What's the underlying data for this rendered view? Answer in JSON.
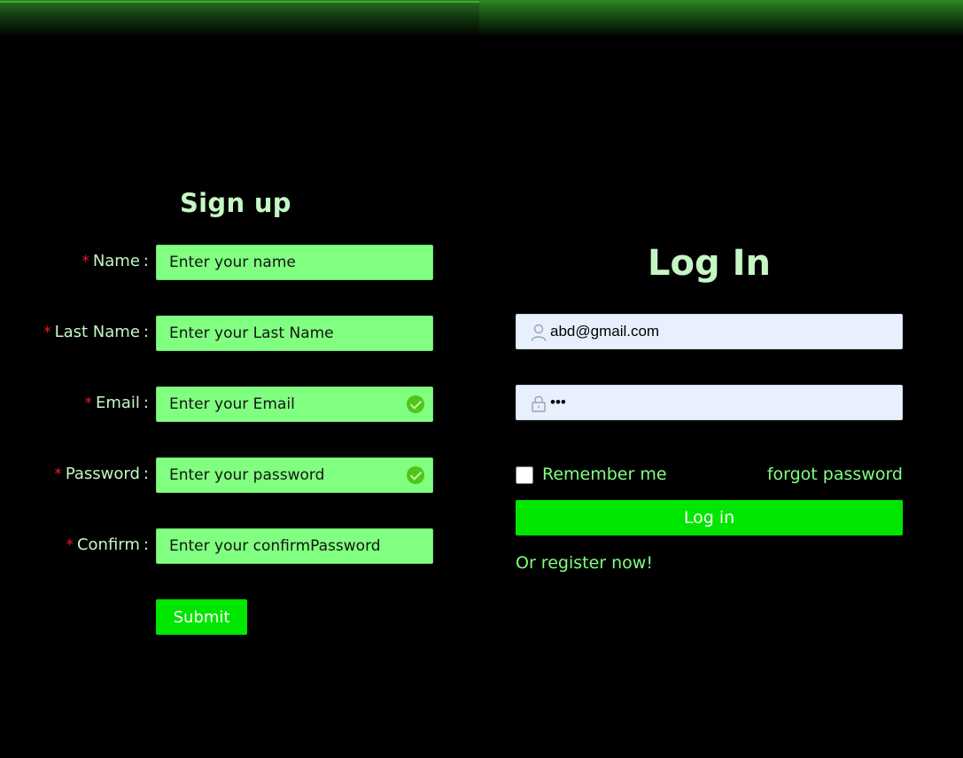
{
  "signup": {
    "title": "Sign up",
    "fields": [
      {
        "label": "Name",
        "placeholder": "Enter your name"
      },
      {
        "label": "Last Name",
        "placeholder": "Enter your Last Name"
      },
      {
        "label": "Email",
        "placeholder": "Enter your Email"
      },
      {
        "label": "Password",
        "placeholder": "Enter your password"
      },
      {
        "label": "Confirm",
        "placeholder": "Enter your confirmPassword"
      }
    ],
    "required_mark": "*",
    "label_separator": ":",
    "submit_label": "Submit"
  },
  "login": {
    "title": "Log In",
    "username_value": "abd@gmail.com",
    "password_value": "•••",
    "remember_label": "Remember me",
    "forgot_label": "forgot password",
    "login_label": "Log in",
    "register_label": "Or register now!"
  },
  "colors": {
    "background": "#000000",
    "accent_green": "#00e600",
    "input_green": "#80ff80",
    "title_green": "#c4f7c4",
    "required_red": "#e32020",
    "login_input_bg": "#e8f0fe"
  },
  "icons": {
    "validated": "check-circle-icon",
    "username": "user-icon",
    "password": "lock-icon"
  }
}
